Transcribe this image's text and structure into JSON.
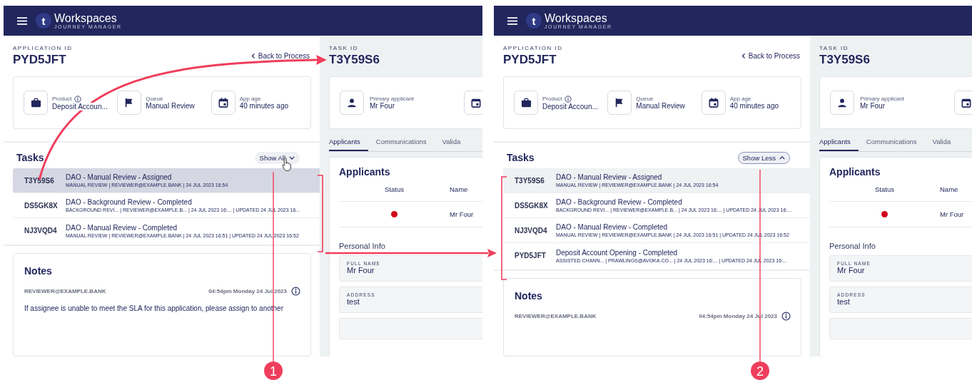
{
  "screens": [
    {
      "header": {
        "logo_letter": "t",
        "brand": "Workspaces",
        "subtitle": "JOURNEY MANAGER"
      },
      "application": {
        "label": "APPLICATION ID",
        "id": "PYD5JFT",
        "back_link": "Back to Process"
      },
      "summary": [
        {
          "kind": "product",
          "label": "Product",
          "value": "Deposit Accoun...",
          "info": true
        },
        {
          "kind": "queue",
          "label": "Queue",
          "value": "Manual Review",
          "info": false
        },
        {
          "kind": "age",
          "label": "App age",
          "value": "40 minutes ago",
          "info": false
        }
      ],
      "tasks": {
        "title": "Tasks",
        "toggle": {
          "label": "Show All",
          "expanded": false,
          "hovered": true
        },
        "rows": [
          {
            "id": "T3Y59S6",
            "title": "DAO - Manual Review - Assigned",
            "meta": "MANUAL REVIEW | REVIEWER@EXAMPLE.BANK | 24 JUL 2023 16:54",
            "selected": true
          },
          {
            "id": "DS5GK8X",
            "title": "DAO - Background Review - Completed",
            "meta": "BACKGROUND REVI... | REVIEWER@EXAMPLE.B... | 24 JUL 2023 16:... | UPDATED 24 JUL 2023 16...",
            "selected": false
          },
          {
            "id": "NJ3VQD4",
            "title": "DAO - Manual Review - Completed",
            "meta": "MANUAL REVIEW | REVIEWER@EXAMPLE.BANK | 24 JUL 2023 16:51 | UPDATED 24 JUL 2023 16:52",
            "selected": false
          }
        ]
      },
      "notes": {
        "title": "Notes",
        "author": "REVIEWER@EXAMPLE.BANK",
        "time": "04:54pm Monday 24 Jul 2023",
        "text": "If assignee is unable to meet the SLA for this application, please assign to another"
      },
      "task_panel": {
        "label": "TASK ID",
        "id": "T3Y59S6",
        "primary": {
          "label": "Primary applicant",
          "value": "Mr Four"
        },
        "tabs": [
          {
            "label": "Applicants",
            "selected": true
          },
          {
            "label": "Communications",
            "selected": false
          },
          {
            "label": "Valida",
            "selected": false
          }
        ],
        "applicants": {
          "title": "Applicants",
          "columns": [
            "Status",
            "Name"
          ],
          "rows": [
            {
              "color": "#d0021b",
              "name": "Mr Four"
            }
          ]
        },
        "personal_info": {
          "title": "Personal Info",
          "fields": [
            {
              "label": "FULL NAME",
              "value": "Mr Four"
            },
            {
              "label": "ADDRESS",
              "value": "test"
            }
          ]
        }
      }
    },
    {
      "header": {
        "logo_letter": "t",
        "brand": "Workspaces",
        "subtitle": "JOURNEY MANAGER"
      },
      "application": {
        "label": "APPLICATION ID",
        "id": "PYD5JFT",
        "back_link": "Back to Process"
      },
      "summary": [
        {
          "kind": "product",
          "label": "Product",
          "value": "Deposit Accoun...",
          "info": true
        },
        {
          "kind": "queue",
          "label": "Queue",
          "value": "Manual Review",
          "info": false
        },
        {
          "kind": "age",
          "label": "App age",
          "value": "40 minutes ago",
          "info": false
        }
      ],
      "tasks": {
        "title": "Tasks",
        "toggle": {
          "label": "Show Less",
          "expanded": true,
          "hovered": false
        },
        "rows": [
          {
            "id": "T3Y59S6",
            "title": "DAO - Manual Review - Assigned",
            "meta": "MANUAL REVIEW | REVIEWER@EXAMPLE.BANK | 24 JUL 2023 16:54",
            "selected": true
          },
          {
            "id": "DS5GK8X",
            "title": "DAO - Background Review - Completed",
            "meta": "BACKGROUND REVI... | REVIEWER@EXAMPLE.B... | 24 JUL 2023 16:... | UPDATED 24 JUL 2023 16:...",
            "selected": false
          },
          {
            "id": "NJ3VQD4",
            "title": "DAO - Manual Review - Completed",
            "meta": "MANUAL REVIEW | REVIEWER@EXAMPLE.BANK | 24 JUL 2023 16:51 | UPDATED 24 JUL 2023 16:52",
            "selected": false
          },
          {
            "id": "PYD5JFT",
            "title": "Deposit Account Opening - Completed",
            "meta": "ASSISTED CHANN... | PRAWLINGS@AVOKA.CO... | 24 JUL 2023 16:... | UPDATED 24 JUL 2023 16:...",
            "selected": false
          }
        ]
      },
      "notes": {
        "title": "Notes",
        "author": "REVIEWER@EXAMPLE.BANK",
        "time": "04:54pm Monday 24 Jul 2023"
      },
      "task_panel": {
        "label": "TASK ID",
        "id": "T3Y59S6",
        "primary": {
          "label": "Primary applicant",
          "value": "Mr Four"
        },
        "tabs": [
          {
            "label": "Applicants",
            "selected": true
          },
          {
            "label": "Communications",
            "selected": false
          },
          {
            "label": "Valida",
            "selected": false
          }
        ],
        "applicants": {
          "title": "Applicants",
          "columns": [
            "Status",
            "Name"
          ],
          "rows": [
            {
              "color": "#d0021b",
              "name": "Mr Four"
            }
          ]
        },
        "personal_info": {
          "title": "Personal Info",
          "fields": [
            {
              "label": "FULL NAME",
              "value": "Mr Four"
            },
            {
              "label": "ADDRESS",
              "value": "test"
            }
          ]
        }
      }
    }
  ],
  "callouts": [
    "1",
    "2"
  ]
}
